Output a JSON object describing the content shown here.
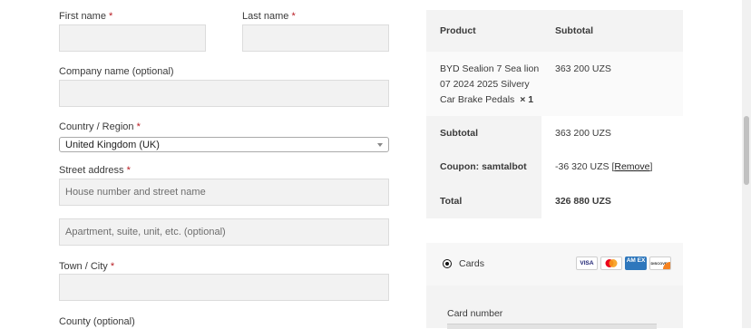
{
  "form": {
    "first_name_label": "First name",
    "last_name_label": "Last name",
    "company_label": "Company name (optional)",
    "country_label": "Country / Region",
    "country_value": "United Kingdom (UK)",
    "street_label": "Street address",
    "street_placeholder": "House number and street name",
    "apartment_placeholder": "Apartment, suite, unit, etc. (optional)",
    "town_label": "Town / City",
    "county_label": "County (optional)",
    "required_mark": "*"
  },
  "order": {
    "col_product": "Product",
    "col_subtotal": "Subtotal",
    "item_name_lines": [
      "BYD Sealion 7 Sea lion",
      "07 2024 2025 Silvery",
      "Car Brake Pedals"
    ],
    "item_qty": "× 1",
    "item_subtotal": "363 200 UZS",
    "subtotal_label": "Subtotal",
    "subtotal_value": "363 200 UZS",
    "coupon_label": "Coupon: samtalbot",
    "coupon_value": "-36 320 UZS",
    "coupon_remove_open": "[",
    "coupon_remove": "Remove",
    "coupon_remove_close": "]",
    "total_label": "Total",
    "total_value": "326 880 UZS"
  },
  "payment": {
    "method_label": "Cards",
    "card_icons": [
      "visa-icon",
      "mastercard-icon",
      "amex-icon",
      "discover-icon"
    ],
    "visa_text": "VISA",
    "amex_text": "AM EX",
    "discover_text": "DISCOVER",
    "card_number_label": "Card number"
  }
}
